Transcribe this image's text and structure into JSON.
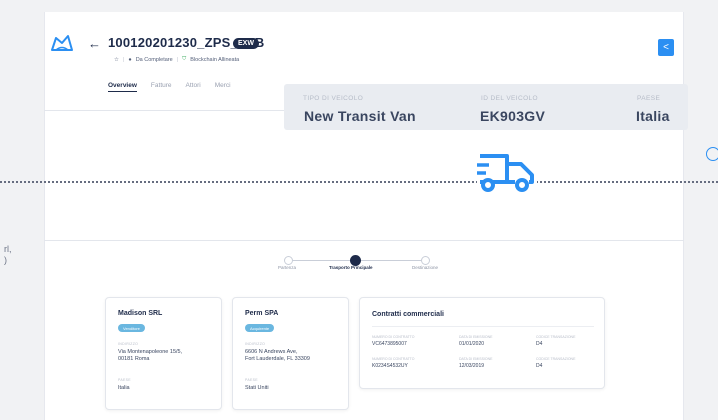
{
  "header": {
    "back_arrow": "←",
    "shipment_id": "100120201230_ZPS_ELB",
    "incoterm": "EXW",
    "star": "☆",
    "status_text": "Da Completare",
    "blockchain_text": "Blockchain Allineata"
  },
  "tabs": [
    "Overview",
    "Fatture",
    "Attori",
    "Merci"
  ],
  "collapse_button": "<",
  "vehicle": {
    "type_label": "TIPO DI VEICOLO",
    "type_value": "New Transit Van",
    "id_label": "ID DEL VEICOLO",
    "id_value": "EK903GV",
    "country_label": "PAESE",
    "country_value": "Italia"
  },
  "left_fragment": [
    "rl,",
    ")"
  ],
  "stepper": {
    "steps": [
      "Partenza",
      "Trasporto Principale",
      "Destinazione"
    ],
    "active_index": 1
  },
  "parties": [
    {
      "name": "Madison SRL",
      "role": "Venditore",
      "address_label": "INDIRIZZO",
      "address": [
        "Via Montenapoleone 15/5,",
        "00181 Roma"
      ],
      "country_label": "PAESE",
      "country": "Italia"
    },
    {
      "name": "Perm SPA",
      "role": "Acquirente",
      "address_label": "INDIRIZZO",
      "address": [
        "6606 N Andrews Ave,",
        "Fort Lauderdale, FL 33309"
      ],
      "country_label": "PAESE",
      "country": "Stati Uniti"
    }
  ],
  "contracts": {
    "title": "Contratti commerciali",
    "rows": [
      {
        "number_label": "NUMERO DI CONTRATTO",
        "number": "VC6473895007",
        "date_label": "DATA DI EMISSIONE",
        "date": "01/01/2020",
        "code_label": "CODICE TRANSAZIONE",
        "code": "D4"
      },
      {
        "number_label": "NUMERO DI CONTRATTO",
        "number": "K0234S4532UY",
        "date_label": "DATA DI EMISSIONE",
        "date": "12/03/2019",
        "code_label": "CODICE TRANSAZIONE",
        "code": "D4"
      }
    ]
  },
  "colors": {
    "navy": "#1e2b4a",
    "accent_blue": "#2b8ff2",
    "badge_blue": "#6ab7e0",
    "green": "#3fae61"
  }
}
